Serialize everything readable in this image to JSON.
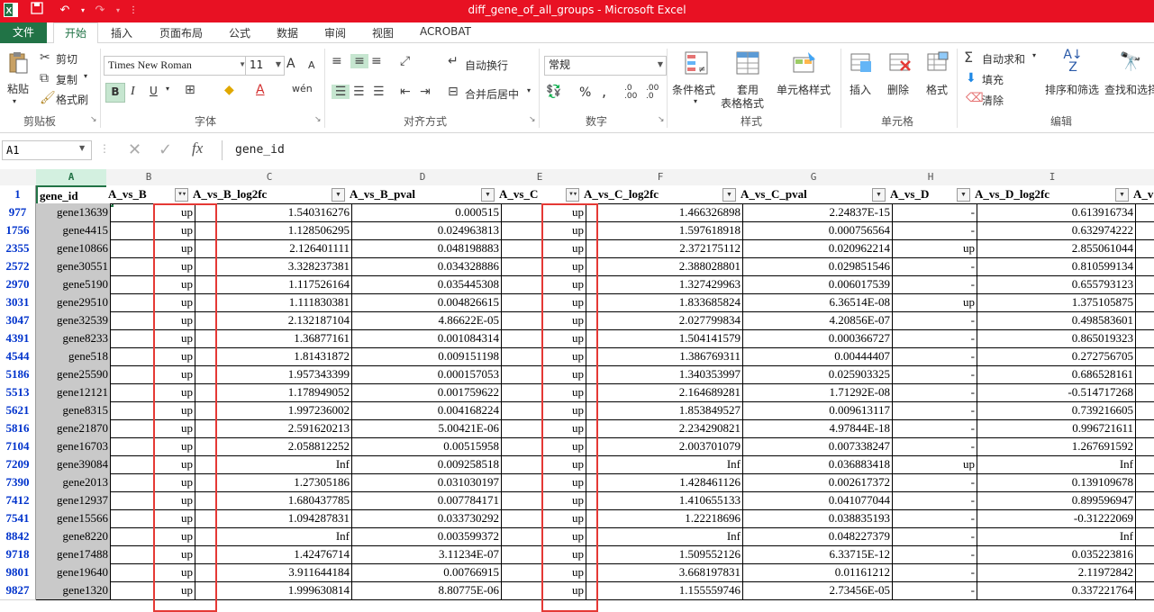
{
  "window": {
    "title": "diff_gene_of_all_groups -  Microsoft Excel"
  },
  "tabs": [
    "文件",
    "开始",
    "插入",
    "页面布局",
    "公式",
    "数据",
    "审阅",
    "视图",
    "ACROBAT"
  ],
  "ribbon": {
    "clipboard": {
      "paste": "粘贴",
      "cut": "剪切",
      "copy": "复制",
      "format_painter": "格式刷",
      "label": "剪贴板"
    },
    "font": {
      "name": "Times New Roman",
      "size": "11",
      "grow": "A",
      "shrink": "A",
      "bold": "B",
      "italic": "I",
      "underline": "U",
      "wen": "wén",
      "label": "字体"
    },
    "alignment": {
      "wrap": "自动换行",
      "merge": "合并后居中",
      "label": "对齐方式"
    },
    "number": {
      "format": "常规",
      "percent": "%",
      "comma": ",",
      "label": "数字"
    },
    "styles": {
      "conditional": "条件格式",
      "table_fmt_1": "套用",
      "table_fmt_2": "表格格式",
      "cell_styles": "单元格样式",
      "label": "样式"
    },
    "cells": {
      "insert": "插入",
      "delete": "删除",
      "format": "格式",
      "label": "单元格"
    },
    "editing": {
      "autosum": "自动求和",
      "fill": "填充",
      "clear": "清除",
      "sort": "排序和筛选",
      "find": "查找和选择",
      "label": "编辑"
    }
  },
  "formula_bar": {
    "name_box": "A1",
    "fx": "fx",
    "content": "gene_id"
  },
  "columns": [
    "A",
    "B",
    "C",
    "D",
    "E",
    "F",
    "G",
    "H",
    "I"
  ],
  "header_row_num": "1",
  "headers": [
    "gene_id",
    "A_vs_B",
    "A_vs_B_log2fc",
    "A_vs_B_pval",
    "A_vs_C",
    "A_vs_C_log2fc",
    "A_vs_C_pval",
    "A_vs_D",
    "A_vs_D_log2fc",
    "A_v"
  ],
  "rows": [
    {
      "n": "977",
      "c": [
        "gene13639",
        "up",
        "1.540316276",
        "0.000515",
        "up",
        "1.466326898",
        "2.24837E-15",
        "-",
        "0.613916734"
      ]
    },
    {
      "n": "1756",
      "c": [
        "gene4415",
        "up",
        "1.128506295",
        "0.024963813",
        "up",
        "1.597618918",
        "0.000756564",
        "-",
        "0.632974222"
      ]
    },
    {
      "n": "2355",
      "c": [
        "gene10866",
        "up",
        "2.126401111",
        "0.048198883",
        "up",
        "2.372175112",
        "0.020962214",
        "up",
        "2.855061044"
      ]
    },
    {
      "n": "2572",
      "c": [
        "gene30551",
        "up",
        "3.328237381",
        "0.034328886",
        "up",
        "2.388028801",
        "0.029851546",
        "-",
        "0.810599134"
      ]
    },
    {
      "n": "2970",
      "c": [
        "gene5190",
        "up",
        "1.117526164",
        "0.035445308",
        "up",
        "1.327429963",
        "0.006017539",
        "-",
        "0.655793123"
      ]
    },
    {
      "n": "3031",
      "c": [
        "gene29510",
        "up",
        "1.111830381",
        "0.004826615",
        "up",
        "1.833685824",
        "6.36514E-08",
        "up",
        "1.375105875"
      ]
    },
    {
      "n": "3047",
      "c": [
        "gene32539",
        "up",
        "2.132187104",
        "4.86622E-05",
        "up",
        "2.027799834",
        "4.20856E-07",
        "-",
        "0.498583601"
      ]
    },
    {
      "n": "4391",
      "c": [
        "gene8233",
        "up",
        "1.36877161",
        "0.001084314",
        "up",
        "1.504141579",
        "0.000366727",
        "-",
        "0.865019323"
      ]
    },
    {
      "n": "4544",
      "c": [
        "gene518",
        "up",
        "1.81431872",
        "0.009151198",
        "up",
        "1.386769311",
        "0.00444407",
        "-",
        "0.272756705"
      ]
    },
    {
      "n": "5186",
      "c": [
        "gene25590",
        "up",
        "1.957343399",
        "0.000157053",
        "up",
        "1.340353997",
        "0.025903325",
        "-",
        "0.686528161"
      ]
    },
    {
      "n": "5513",
      "c": [
        "gene12121",
        "up",
        "1.178949052",
        "0.001759622",
        "up",
        "2.164689281",
        "1.71292E-08",
        "-",
        "-0.514717268"
      ]
    },
    {
      "n": "5621",
      "c": [
        "gene8315",
        "up",
        "1.997236002",
        "0.004168224",
        "up",
        "1.853849527",
        "0.009613117",
        "-",
        "0.739216605"
      ]
    },
    {
      "n": "5816",
      "c": [
        "gene21870",
        "up",
        "2.591620213",
        "5.00421E-06",
        "up",
        "2.234290821",
        "4.97844E-18",
        "-",
        "0.996721611"
      ]
    },
    {
      "n": "7104",
      "c": [
        "gene16703",
        "up",
        "2.058812252",
        "0.00515958",
        "up",
        "2.003701079",
        "0.007338247",
        "-",
        "1.267691592"
      ]
    },
    {
      "n": "7209",
      "c": [
        "gene39084",
        "up",
        "Inf",
        "0.009258518",
        "up",
        "Inf",
        "0.036883418",
        "up",
        "Inf"
      ]
    },
    {
      "n": "7390",
      "c": [
        "gene2013",
        "up",
        "1.27305186",
        "0.031030197",
        "up",
        "1.428461126",
        "0.002617372",
        "-",
        "0.139109678"
      ]
    },
    {
      "n": "7412",
      "c": [
        "gene12937",
        "up",
        "1.680437785",
        "0.007784171",
        "up",
        "1.410655133",
        "0.041077044",
        "-",
        "0.899596947"
      ]
    },
    {
      "n": "7541",
      "c": [
        "gene15566",
        "up",
        "1.094287831",
        "0.033730292",
        "up",
        "1.22218696",
        "0.038835193",
        "-",
        "-0.31222069"
      ]
    },
    {
      "n": "8842",
      "c": [
        "gene8220",
        "up",
        "Inf",
        "0.003599372",
        "up",
        "Inf",
        "0.048227379",
        "-",
        "Inf"
      ]
    },
    {
      "n": "9718",
      "c": [
        "gene17488",
        "up",
        "1.42476714",
        "3.11234E-07",
        "up",
        "1.509552126",
        "6.33715E-12",
        "-",
        "0.035223816"
      ]
    },
    {
      "n": "9801",
      "c": [
        "gene19640",
        "up",
        "3.911644184",
        "0.00766915",
        "up",
        "3.668197831",
        "0.01161212",
        "-",
        "2.11972842"
      ]
    },
    {
      "n": "9827",
      "c": [
        "gene1320",
        "up",
        "1.999630814",
        "8.80775E-06",
        "up",
        "1.155559746",
        "2.73456E-05",
        "-",
        "0.337221764"
      ]
    }
  ],
  "accent_colors": {
    "excel_green": "#217346",
    "title_red": "#e81123",
    "highlight_red": "#e53935",
    "row_number_blue": "#0033cc"
  }
}
